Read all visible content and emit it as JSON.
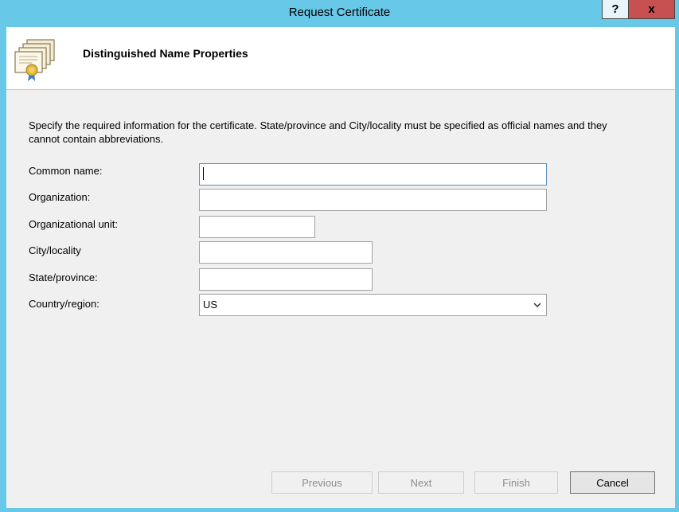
{
  "window": {
    "title": "Request Certificate",
    "help_label": "?",
    "close_label": "x"
  },
  "header": {
    "title": "Distinguished Name Properties"
  },
  "description": "Specify the required information for the certificate. State/province and City/locality must be specified as official names and they cannot contain abbreviations.",
  "form": {
    "common_name": {
      "label": "Common name:",
      "value": ""
    },
    "organization": {
      "label": "Organization:",
      "value": ""
    },
    "org_unit": {
      "label": "Organizational unit:",
      "value": ""
    },
    "city": {
      "label": "City/locality",
      "value": ""
    },
    "state": {
      "label": "State/province:",
      "value": ""
    },
    "country": {
      "label": "Country/region:",
      "value": "US"
    }
  },
  "buttons": {
    "previous": "Previous",
    "next": "Next",
    "finish": "Finish",
    "cancel": "Cancel"
  },
  "colors": {
    "title_bar": "#68c8e8",
    "close_button": "#c75050"
  }
}
